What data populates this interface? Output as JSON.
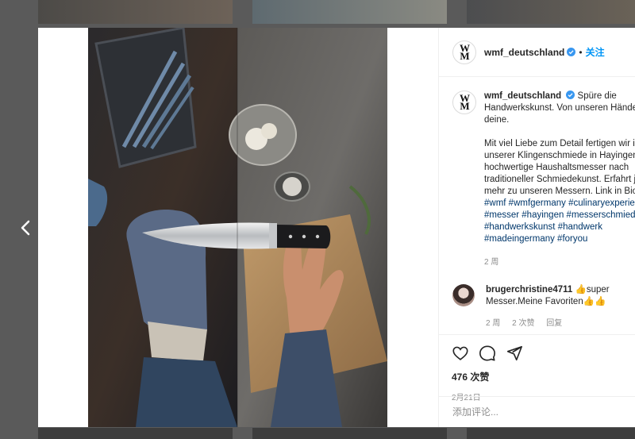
{
  "post": {
    "username": "wmf_deutschland",
    "separator": "•",
    "follow_label": "关注",
    "logo_text_top": "W",
    "logo_text_bottom": "M",
    "caption": {
      "username": "wmf_deutschland",
      "line1": "Spüre die",
      "line2": "Handwerkskunst. Von unseren Hände",
      "line3": "deine.",
      "para2": [
        "Mit viel Liebe zum Detail fertigen wir i",
        "unserer Klingenschmiede in Hayingen",
        "hochwertige Haushaltsmesser nach",
        "traditioneller Schmiedekunst. Erfahrt j",
        "mehr zu unseren Messern. Link in Bio"
      ],
      "hashtags": [
        "#wmf #wmfgermany #culinaryexperie",
        "#messer #hayingen #messerschmied",
        "#handwerkskunst #handwerk",
        "#madeingermany #foryou"
      ],
      "time": "2 周"
    },
    "comment": {
      "username": "brugerchristine4711",
      "text_a": "👍super",
      "text_b": "Messer.Meine Favoriten👍👍",
      "time": "2 周",
      "likes": "2 次赞",
      "reply": "回复"
    },
    "likes": "476 次赞",
    "date": "2月21日",
    "comment_placeholder": "添加评论..."
  },
  "icons": {
    "prev": "chevron-left-icon",
    "like": "heart-icon",
    "comment": "comment-icon",
    "share": "share-icon",
    "verified": "verified-badge-icon"
  },
  "colors": {
    "link": "#0095f6",
    "hashtag": "#00376b",
    "verified": "#3897f0",
    "muted": "#8e8e8e"
  }
}
